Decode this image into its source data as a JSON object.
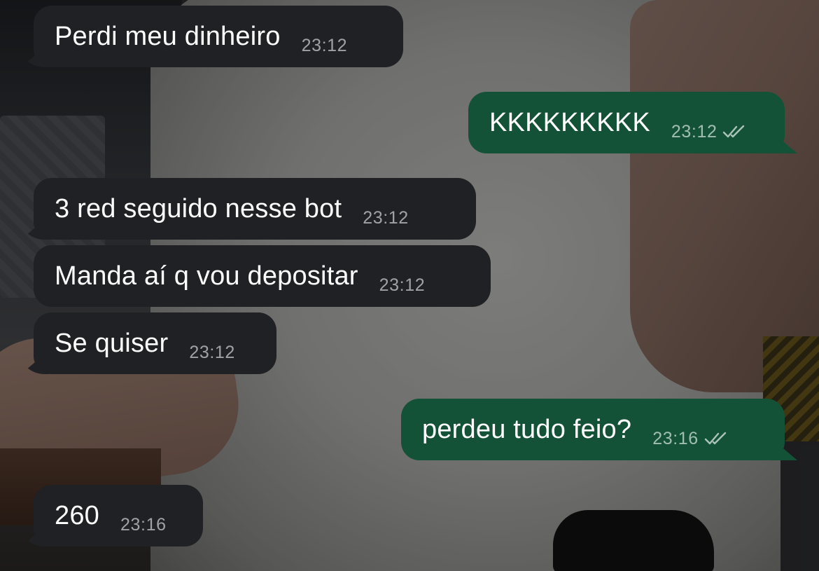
{
  "messages": [
    {
      "direction": "incoming",
      "text": "Perdi meu dinheiro",
      "time": "23:12"
    },
    {
      "direction": "outgoing",
      "text": "KKKKKKKKK",
      "time": "23:12",
      "status": "read-ticks-icon"
    },
    {
      "direction": "incoming",
      "text": "3 red seguido nesse bot",
      "time": "23:12"
    },
    {
      "direction": "incoming",
      "text": "Manda aí q vou depositar",
      "time": "23:12"
    },
    {
      "direction": "incoming",
      "text": "Se quiser",
      "time": "23:12"
    },
    {
      "direction": "outgoing",
      "text": "perdeu tudo feio?",
      "time": "23:16",
      "status": "read-ticks-icon"
    },
    {
      "direction": "incoming",
      "text": "260",
      "time": "23:16"
    }
  ],
  "colors": {
    "incoming_bubble": "#202124",
    "outgoing_bubble": "#145238",
    "text": "#ffffff",
    "timestamp": "#9a9a9a"
  }
}
